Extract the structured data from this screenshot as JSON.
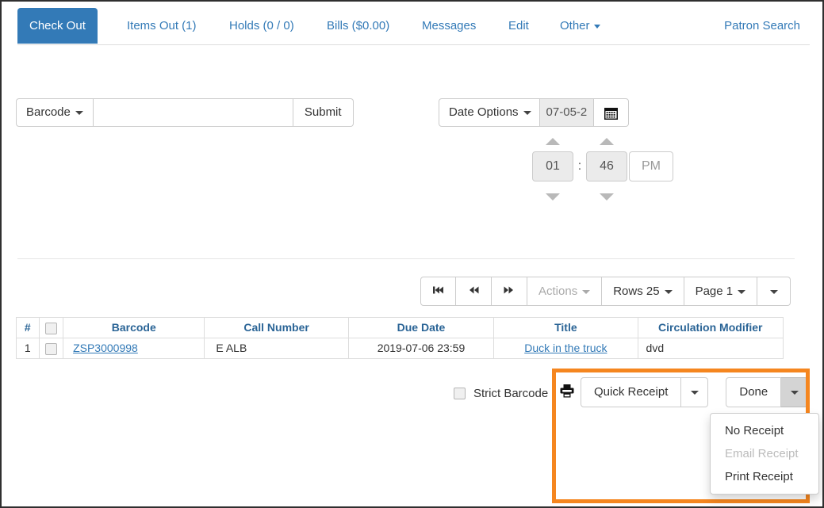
{
  "colors": {
    "accent_blue": "#337ab7",
    "link_blue": "#337ab7",
    "header_blue": "#2a6496",
    "highlight_orange": "#f5861f",
    "disabled_gray": "#bbbbbb"
  },
  "tabs": {
    "items": [
      {
        "label": "Check Out",
        "active": true
      },
      {
        "label": "Items Out (1)",
        "active": false
      },
      {
        "label": "Holds (0 / 0)",
        "active": false
      },
      {
        "label": "Bills ($0.00)",
        "active": false
      },
      {
        "label": "Messages",
        "active": false
      },
      {
        "label": "Edit",
        "active": false
      },
      {
        "label": "Other",
        "active": false,
        "caret": true
      }
    ],
    "patron_search": "Patron Search"
  },
  "barcode_group": {
    "type_label": "Barcode",
    "input_value": "",
    "input_placeholder": "",
    "submit_label": "Submit"
  },
  "date_options": {
    "label": "Date Options",
    "date_value": "07-05-2",
    "calendar_icon": "calendar-icon"
  },
  "time_picker": {
    "hour": "01",
    "separator": ":",
    "minute": "46",
    "meridiem": "PM"
  },
  "grid_toolbar": {
    "first_page_icon": "⏮",
    "prev_page_icon": "◀◀",
    "next_page_icon": "▶▶",
    "actions_label": "Actions",
    "rows_label": "Rows 25",
    "page_label": "Page 1"
  },
  "grid": {
    "columns": [
      "#",
      "",
      "Barcode",
      "Call Number",
      "Due Date",
      "Title",
      "Circulation Modifier"
    ],
    "rows": [
      {
        "num": "1",
        "barcode": "ZSP3000998",
        "call_number": "E ALB",
        "due_date": "2019-07-06 23:59",
        "title": "Duck in the truck",
        "circulation_modifier": "dvd"
      }
    ]
  },
  "strict_barcode": {
    "label": "Strict Barcode",
    "checked": false
  },
  "receipt": {
    "printer_icon": "printer-icon",
    "quick_receipt_label": "Quick Receipt",
    "done_label": "Done",
    "menu_items": [
      {
        "label": "No Receipt",
        "disabled": false
      },
      {
        "label": "Email Receipt",
        "disabled": true
      },
      {
        "label": "Print Receipt",
        "disabled": false
      }
    ]
  }
}
